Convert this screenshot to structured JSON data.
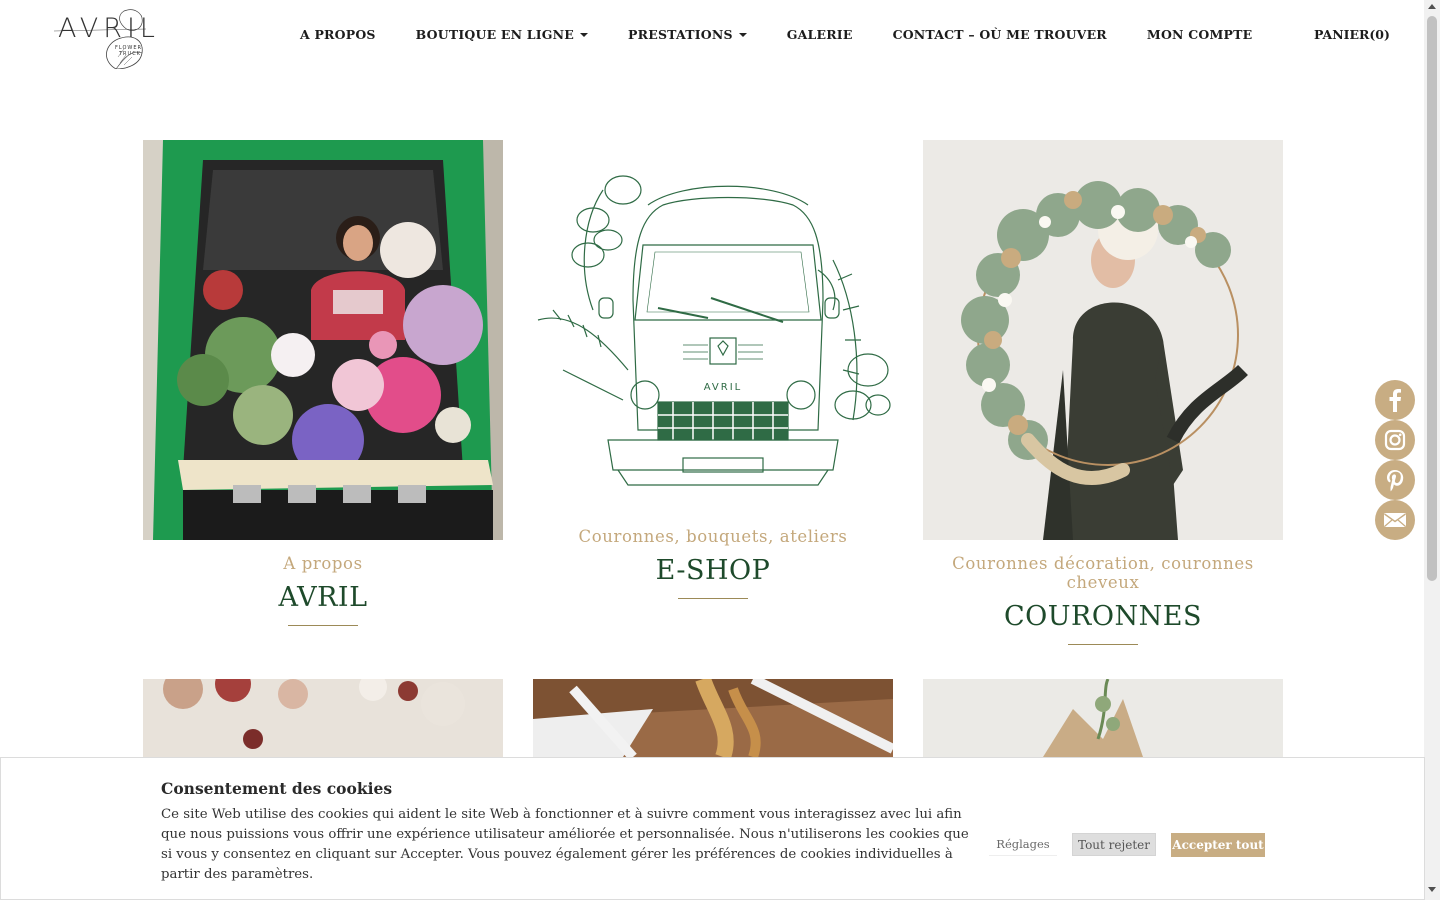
{
  "header": {
    "logo_text": "AVRIL",
    "logo_sub_line1": "FLOWER",
    "logo_sub_line2": "TRUCK",
    "nav": [
      {
        "label": "A PROPOS",
        "has_dropdown": false
      },
      {
        "label": "BOUTIQUE EN LIGNE",
        "has_dropdown": true
      },
      {
        "label": "PRESTATIONS",
        "has_dropdown": true
      },
      {
        "label": "GALERIE",
        "has_dropdown": false
      },
      {
        "label": "CONTACT – OÙ ME TROUVER",
        "has_dropdown": false
      },
      {
        "label": "MON COMPTE",
        "has_dropdown": false
      }
    ],
    "cart_label": "PANIER(0)"
  },
  "cards": [
    {
      "subtitle": "A propos",
      "title": "AVRIL",
      "image": "florist-in-green-van-photo"
    },
    {
      "subtitle": "Couronnes, bouquets, ateliers",
      "title": "E-SHOP",
      "image": "van-line-illustration",
      "van_badge": "AVRIL"
    },
    {
      "subtitle": "Couronnes décoration, couronnes cheveux",
      "title": "COURONNES",
      "image": "dried-flower-hoop-wreath-photo"
    }
  ],
  "bottom_images": [
    "dried-flowers-photo",
    "hanging-dried-flowers-photo",
    "bouquet-photo"
  ],
  "social": [
    "facebook-icon",
    "instagram-icon",
    "pinterest-icon",
    "mail-icon"
  ],
  "cookie": {
    "title": "Consentement des cookies",
    "text": "Ce site Web utilise des cookies qui aident le site Web à fonctionner et à suivre comment vous interagissez avec lui afin que nous puissions vous offrir une expérience utilisateur améliorée et personnalisée. Nous n'utiliserons les cookies que si vous y consentez en cliquant sur Accepter. Vous pouvez également gérer les préférences de cookies individuelles à partir des paramètres.",
    "settings_label": "Réglages",
    "reject_label": "Tout rejeter",
    "accept_label": "Accepter tout"
  },
  "colors": {
    "accent_gold": "#c8ad83",
    "subtitle_gold": "#c4a87c",
    "title_green": "#1e4a2b",
    "van_green": "#2f6b45"
  }
}
